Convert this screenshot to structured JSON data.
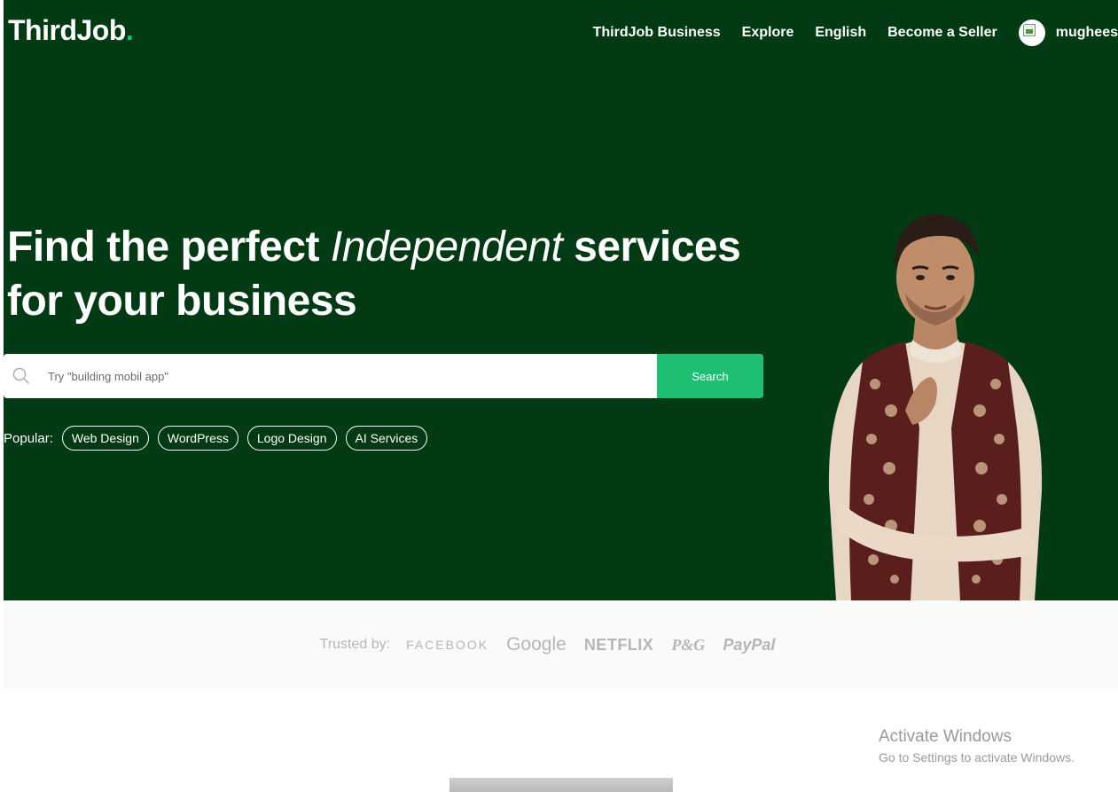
{
  "header": {
    "logo": "ThirdJob",
    "logo_dot": ".",
    "nav": {
      "business": "ThirdJob Business",
      "explore": "Explore",
      "language": "English",
      "become_seller": "Become a Seller",
      "username": "mughees"
    }
  },
  "hero": {
    "headline_part1": "Find the perfect ",
    "headline_italic": "Independent",
    "headline_part2": " services for your business",
    "search": {
      "placeholder": "Try \"building mobil app\"",
      "button_label": "Search"
    },
    "popular_label": "Popular:",
    "popular_tags": [
      "Web Design",
      "WordPress",
      "Logo Design",
      "AI Services"
    ]
  },
  "trusted": {
    "label": "Trusted by:",
    "brands": [
      "FACEBOOK",
      "Google",
      "NETFLIX",
      "P&G",
      "PayPal"
    ]
  },
  "watermark": {
    "title": "Activate Windows",
    "subtitle": "Go to Settings to activate Windows."
  },
  "colors": {
    "hero_background": "#023a14",
    "accent": "#1dbf73",
    "trusted_background": "#fafafa",
    "brand_gray": "#b5b6ba"
  },
  "icons": {
    "search": "search-icon",
    "avatar": "avatar-broken-image-icon"
  }
}
